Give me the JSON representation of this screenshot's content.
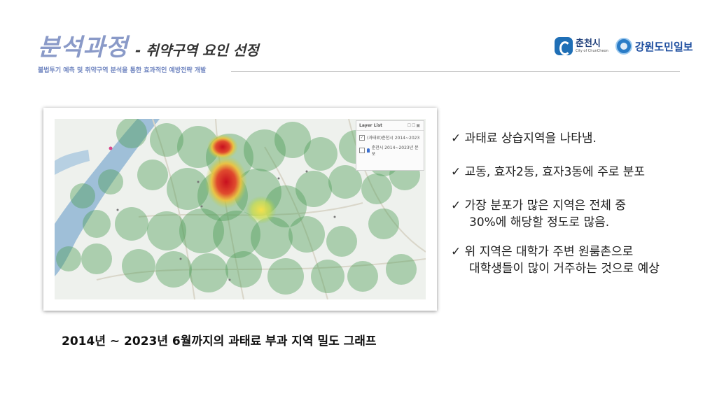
{
  "header": {
    "title": "분석과정",
    "subtitle": "- 취약구역 요인 선정",
    "subline": "불법투기 예측 및 취약구역 분석을 통한 효과적인 예방전략 개발"
  },
  "logos": {
    "chuncheon": {
      "name": "춘천시",
      "english": "City of ChunCheon",
      "icon": "chuncheon-logo-icon"
    },
    "gangwon": {
      "name": "강원도민일보",
      "icon": "gangwon-logo-icon"
    }
  },
  "map": {
    "layer_list": {
      "title": "Layer List",
      "items": [
        "(과태료)춘천시 2014~2023",
        "춘천시 2014~2023년 분포"
      ]
    },
    "colors": {
      "river": "#9fbfd8",
      "green_buffer": "#4f9e57",
      "hot": "#d2232a",
      "warm": "#f2d13a"
    }
  },
  "bullets": [
    {
      "mark": "✓",
      "lines": [
        "과태료 상습지역을 나타냄."
      ]
    },
    {
      "mark": "✓",
      "lines": [
        "교동, 효자2동, 효자3동에 주로 분포"
      ]
    },
    {
      "mark": "✓",
      "lines": [
        "가장 분포가 많은 지역은 전체 중",
        "30%에 해당할 정도로 많음."
      ]
    },
    {
      "mark": "✓",
      "lines": [
        "위 지역은 대학가 주변 원룸촌으로",
        "대학생들이 많이 거주하는 것으로 예상"
      ]
    }
  ],
  "caption": "2014년 ~ 2023년 6월까지의 과태료 부과 지역 밀도 그래프"
}
